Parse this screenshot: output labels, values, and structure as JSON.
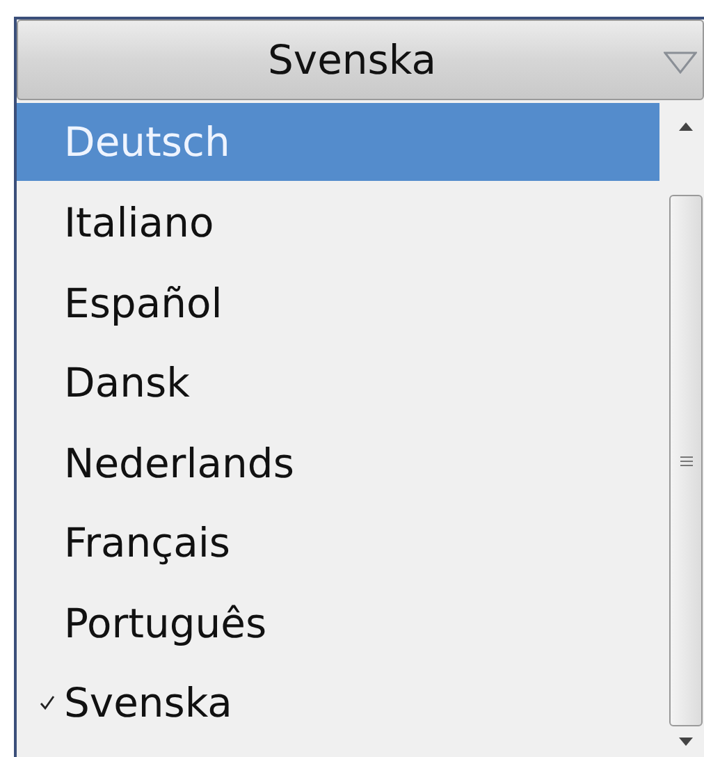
{
  "dropdown": {
    "value": "Svenska"
  },
  "options": [
    {
      "label": "Deutsch",
      "highlighted": true,
      "checked": false
    },
    {
      "label": "Italiano",
      "highlighted": false,
      "checked": false
    },
    {
      "label": "Español",
      "highlighted": false,
      "checked": false
    },
    {
      "label": "Dansk",
      "highlighted": false,
      "checked": false
    },
    {
      "label": "Nederlands",
      "highlighted": false,
      "checked": false
    },
    {
      "label": "Français",
      "highlighted": false,
      "checked": false
    },
    {
      "label": "Português",
      "highlighted": false,
      "checked": false
    },
    {
      "label": "Svenska",
      "highlighted": false,
      "checked": true
    }
  ]
}
